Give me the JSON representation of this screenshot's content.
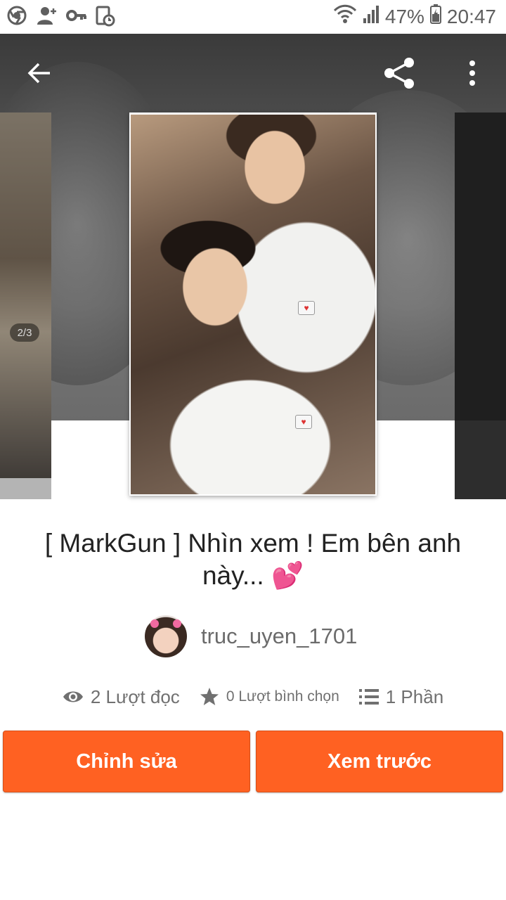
{
  "status_bar": {
    "battery_percent": "47%",
    "time": "20:47",
    "icons": [
      "chrome-icon",
      "add-person-icon",
      "key-icon",
      "alarm-file-icon",
      "wifi-icon",
      "signal-icon",
      "battery-icon"
    ]
  },
  "app_bar": {
    "icons": [
      "back-arrow-icon",
      "share-icon",
      "more-vertical-icon"
    ]
  },
  "carousel": {
    "page_indicator": "2/3"
  },
  "story": {
    "title": "[ MarkGun ] Nhìn xem ! Em bên anh này...",
    "title_emoji": "💕",
    "author": "truc_uyen_1701"
  },
  "stats": {
    "reads": "2 Lượt đọc",
    "votes": "0 Lượt bình chọn",
    "parts": "1 Phần"
  },
  "actions": {
    "edit": "Chỉnh sửa",
    "preview": "Xem trước"
  },
  "colors": {
    "accent": "#ff6122",
    "text_primary": "#222222",
    "text_secondary": "#6b6b6b"
  }
}
